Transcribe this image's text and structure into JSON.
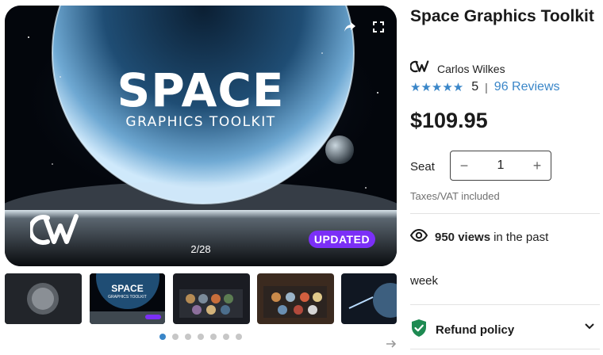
{
  "gallery": {
    "hero": {
      "title_big": "SPACE",
      "title_small": "GRAPHICS TOOLKIT",
      "badge": "UPDATED",
      "counter": "2/28",
      "share_icon": "share-icon",
      "fullscreen_icon": "fullscreen-icon"
    },
    "thumbnails": [
      {
        "label": "",
        "badge": ""
      },
      {
        "label": "SPACE",
        "sub": "GRAPHICS TOOLKIT",
        "badge": "UPDATED"
      },
      {
        "label": "",
        "badge": ""
      },
      {
        "label": "",
        "badge": ""
      },
      {
        "label": "",
        "badge": ""
      }
    ],
    "dots": {
      "count": 7,
      "active_index": 0
    },
    "next_icon": "arrow-right-icon"
  },
  "product": {
    "title": "Space Graphics Toolkit",
    "seller": {
      "name": "Carlos Wilkes",
      "logo": "cw-logo"
    },
    "rating": {
      "stars": "★★★★★",
      "score": "5",
      "separator": "|",
      "reviews": "96 Reviews"
    },
    "price": "$109.95",
    "seat": {
      "label": "Seat",
      "quantity": "1",
      "minus": "−",
      "plus": "+"
    },
    "tax_note": "Taxes/VAT included",
    "views": {
      "count": "950 views",
      "rest": "in the past",
      "week": "week",
      "icon": "eye-icon"
    },
    "refund": {
      "label": "Refund policy",
      "icon": "shield-check-icon",
      "chevron": "chevron-down-icon"
    }
  },
  "colors": {
    "accent": "#3a86c8",
    "badge": "#7b2ff7",
    "refund_shield": "#1e8a52"
  }
}
